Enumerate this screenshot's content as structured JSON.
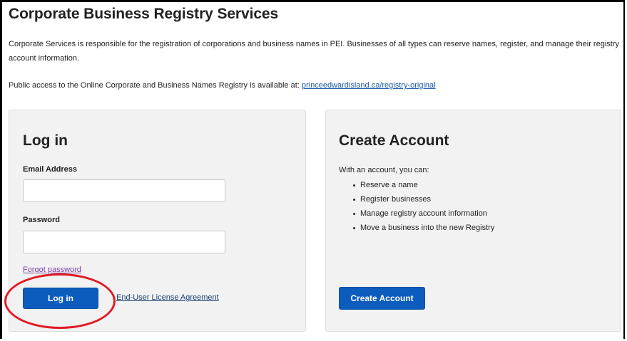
{
  "page": {
    "title": "Corporate Business Registry Services",
    "intro": "Corporate Services is responsible for the registration of corporations and business names in PEI. Businesses of all types can reserve names, register, and manage their registry account information.",
    "access_text": "Public access to the Online Corporate and Business Names Registry is available at: ",
    "access_link": "princeedwardisland.ca/registry-original"
  },
  "login": {
    "heading": "Log in",
    "email_label": "Email Address",
    "email_value": "",
    "password_label": "Password",
    "password_value": "",
    "forgot_password": "Forgot password",
    "submit_label": "Log in",
    "eula_link": "End-User License Agreement"
  },
  "create_account": {
    "heading": "Create Account",
    "intro": "With an account, you can:",
    "benefits": [
      "Reserve a name",
      "Register businesses",
      "Manage registry account information",
      "Move a business into the new Registry"
    ],
    "button_label": "Create Account"
  },
  "colors": {
    "primary_button": "#0b5cbd",
    "link": "#1a5aa6",
    "visited_link": "#7b3fa6",
    "panel_background": "#f2f2f2",
    "annotation_circle": "#e01b24"
  }
}
